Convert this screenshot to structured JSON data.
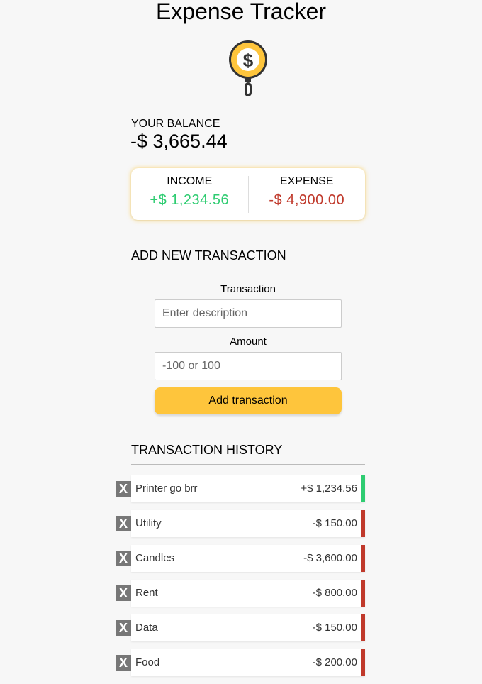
{
  "app": {
    "title": "Expense Tracker"
  },
  "balance": {
    "label": "YOUR BALANCE",
    "value": "-$ 3,665.44"
  },
  "summary": {
    "income_label": "INCOME",
    "income_value": "+$ 1,234.56",
    "expense_label": "EXPENSE",
    "expense_value": "-$ 4,900.00"
  },
  "form": {
    "heading": "ADD NEW TRANSACTION",
    "transaction_label": "Transaction",
    "transaction_placeholder": "Enter description",
    "amount_label": "Amount",
    "amount_placeholder": "-100 or 100",
    "submit_label": "Add transaction"
  },
  "history": {
    "heading": "TRANSACTION HISTORY",
    "delete_label": "X",
    "items": [
      {
        "description": "Printer go brr",
        "amount": "+$ 1,234.56",
        "type": "income"
      },
      {
        "description": "Utility",
        "amount": "-$ 150.00",
        "type": "expense"
      },
      {
        "description": "Candles",
        "amount": "-$ 3,600.00",
        "type": "expense"
      },
      {
        "description": "Rent",
        "amount": "-$ 800.00",
        "type": "expense"
      },
      {
        "description": "Data",
        "amount": "-$ 150.00",
        "type": "expense"
      },
      {
        "description": "Food",
        "amount": "-$ 200.00",
        "type": "expense"
      }
    ]
  },
  "colors": {
    "income": "#2ecc71",
    "expense": "#c0392b",
    "accent": "#fec53c"
  },
  "icons": {
    "logo": "dollar-magnifier-icon"
  }
}
